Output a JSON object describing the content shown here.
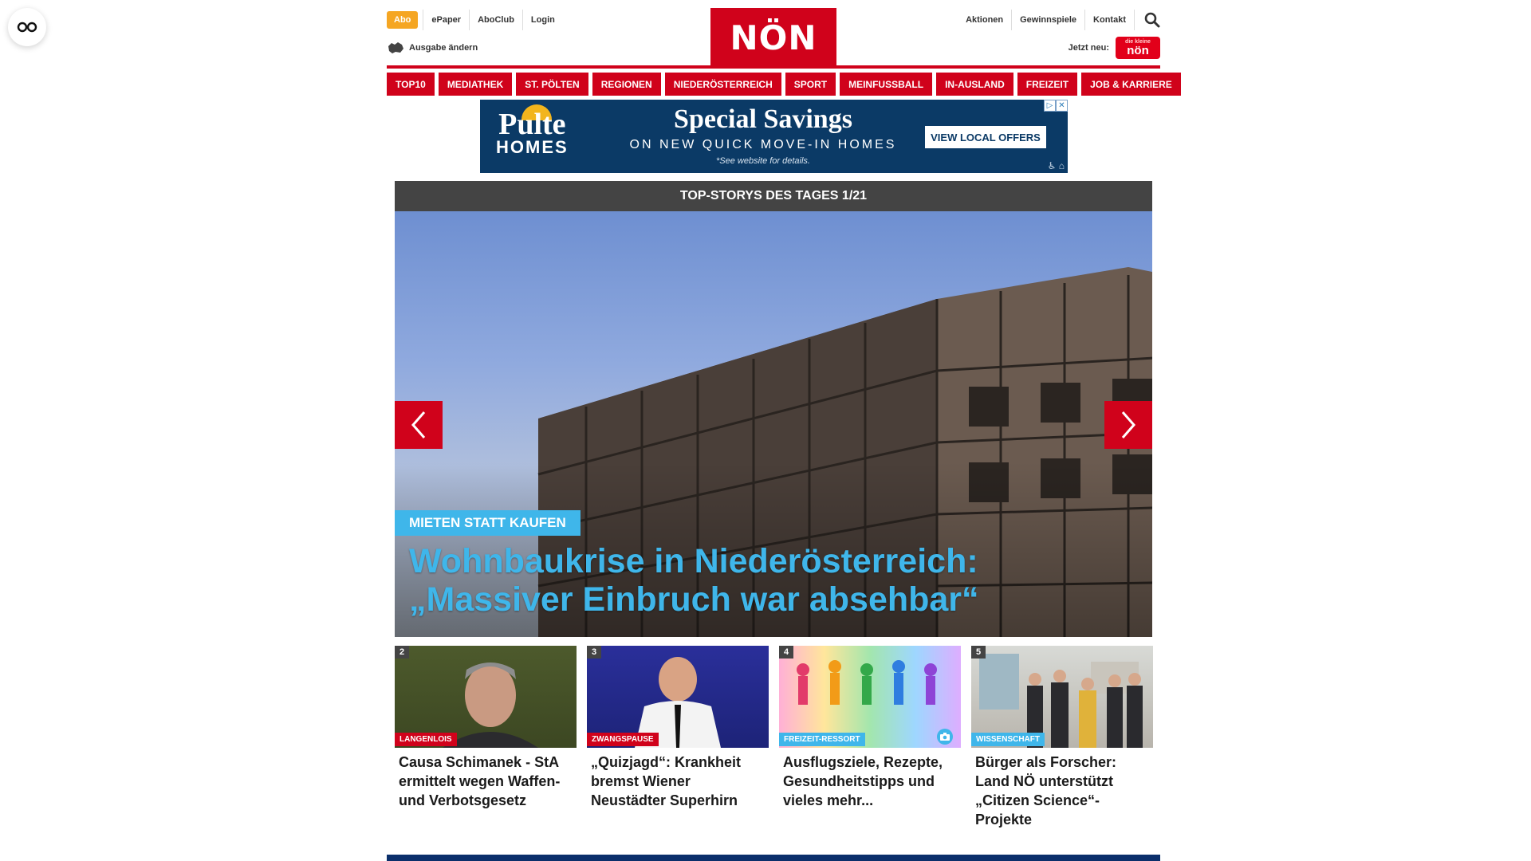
{
  "header": {
    "abo_label": "Abo",
    "top_links": [
      "ePaper",
      "AboClub",
      "Login"
    ],
    "edition_label": "Ausgabe ändern",
    "logo_text": "NÖN",
    "right_links": [
      "Aktionen",
      "Gewinnspiele",
      "Kontakt"
    ],
    "jetzt_label": "Jetzt neu:",
    "badge_small": "die kleine",
    "badge_big": "nön"
  },
  "nav": {
    "items": [
      "TOP10",
      "MEDIATHEK",
      "ST. PÖLTEN",
      "REGIONEN",
      "NIEDERÖSTERREICH",
      "SPORT",
      "MEINFUSSBALL",
      "IN-AUSLAND",
      "FREIZEIT",
      "JOB & KARRIERE"
    ]
  },
  "ad": {
    "brand_top": "Pulte",
    "brand_bottom": "HOMES",
    "headline": "Special Savings",
    "subline": "ON NEW QUICK MOVE-IN HOMES",
    "note": "*See website for details.",
    "cta": "VIEW LOCAL OFFERS"
  },
  "slider": {
    "header": "TOP-STORYS DES TAGES 1/21",
    "kicker": "MIETEN STATT KAUFEN",
    "title": "Wohnbaukrise in Niederösterreich: „Massiver Einbruch war absehbar“"
  },
  "cards": [
    {
      "number": "2",
      "tag": "LANGENLOIS",
      "title": "Causa Schimanek - StA ermittelt wegen Waffen- und Verbotsgesetz"
    },
    {
      "number": "3",
      "tag": "ZWANGSPAUSE",
      "title": "„Quizjagd“: Krankheit bremst Wiener Neustädter Superhirn"
    },
    {
      "number": "4",
      "tag": "FREIZEIT-RESSORT",
      "title": "Ausflugsziele, Rezepte, Gesundheitstipps und vieles mehr..."
    },
    {
      "number": "5",
      "tag": "WISSENSCHAFT",
      "title": "Bürger als Forscher: Land NÖ unterstützt „Citizen Science“-Projekte"
    }
  ],
  "colors": {
    "brand_red": "#d0021b",
    "accent_blue": "#3fb6ea",
    "abo_orange": "#f5a623",
    "slider_header": "#444444"
  }
}
